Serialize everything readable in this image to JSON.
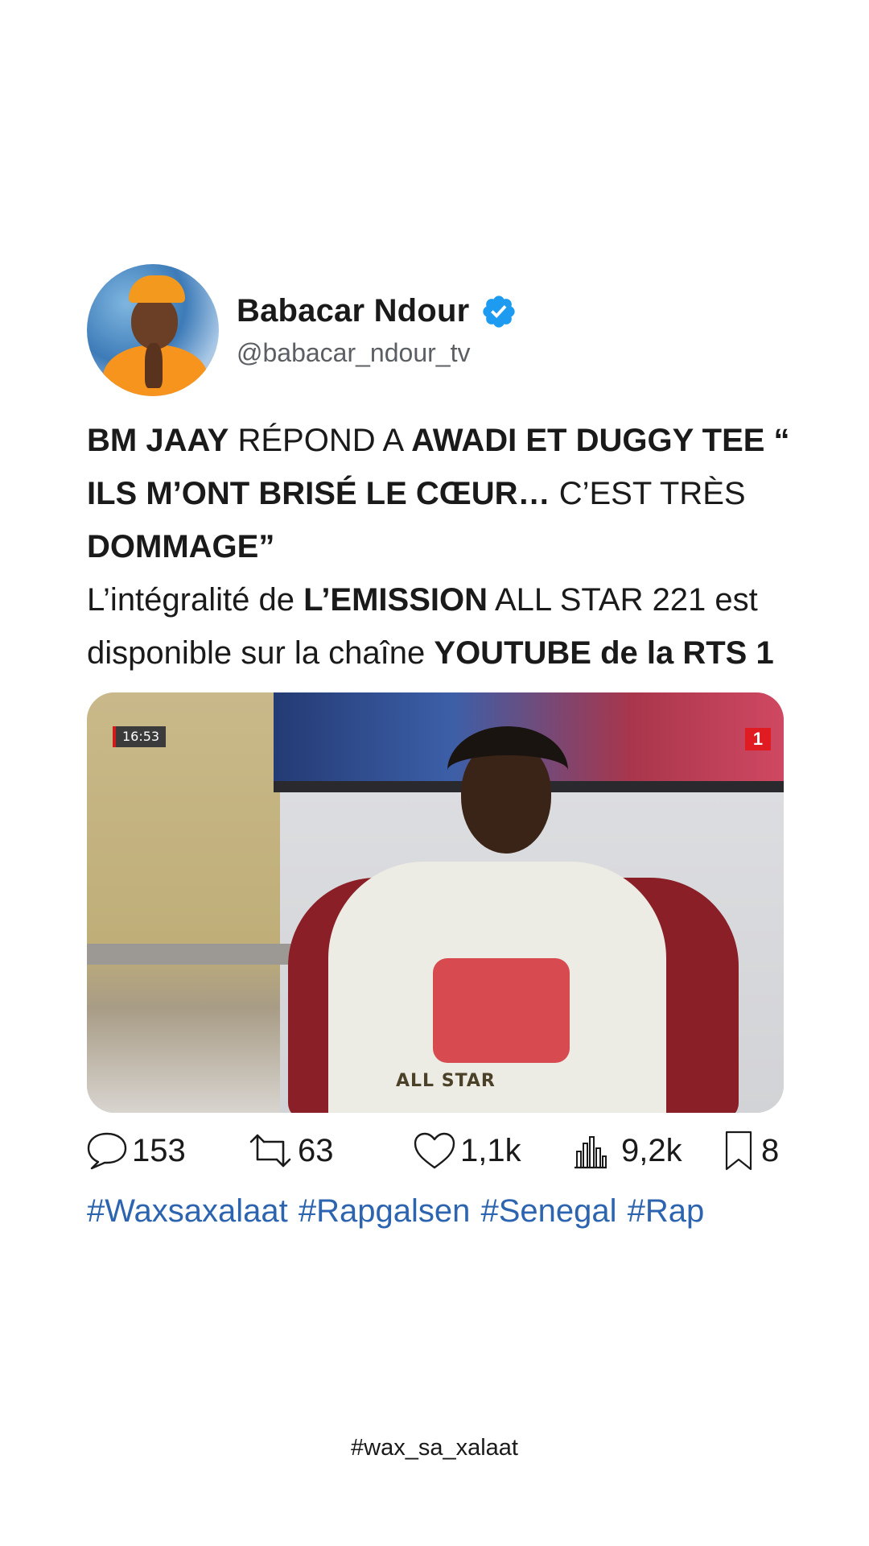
{
  "author": {
    "display_name": "Babacar Ndour",
    "handle": "@babacar_ndour_tv",
    "verified": true,
    "avatar_icon": "profile-photo"
  },
  "post": {
    "segments": [
      {
        "text": "BM JAAY",
        "bold": true
      },
      {
        "text": " RÉPOND A ",
        "bold": false
      },
      {
        "text": "AWADI ET DUGGY TEE “ ILS M’ONT BRISÉ LE CŒUR…",
        "bold": true
      },
      {
        "text": " C’EST TRÈS ",
        "bold": false
      },
      {
        "text": "DOMMAGE”",
        "bold": true
      },
      {
        "text": "\n",
        "bold": false
      },
      {
        "text": "L’intégralité de ",
        "bold": false
      },
      {
        "text": "L’EMISSION",
        "bold": true
      },
      {
        "text": " ALL STAR 221 est disponible sur la chaîne ",
        "bold": false
      },
      {
        "text": "YOUTUBE de la RTS 1",
        "bold": true
      }
    ]
  },
  "media": {
    "timestamp": "16:53",
    "channel_logo": "1",
    "watermark": "ALL STAR"
  },
  "stats": {
    "replies": "153",
    "reposts": "63",
    "likes": "1,1k",
    "views": "9,2k",
    "bookmarks": "8"
  },
  "hashtags": "#Waxsaxalaat #Rapgalsen #Senegal #Rap",
  "footer_tag": "#wax_sa_xalaat",
  "colors": {
    "verified_badge": "#1d9bf0",
    "hashtag": "#2c64b0",
    "text": "#1a1a1a",
    "handle": "#5b5f63"
  }
}
